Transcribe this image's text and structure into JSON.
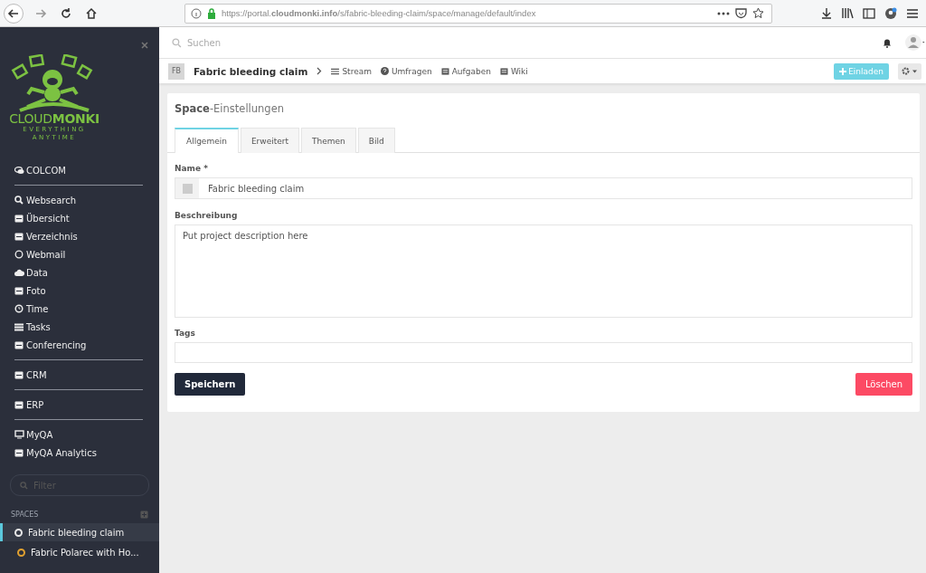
{
  "browser": {
    "url": "https://portal.**cloudmonki.info**/s/fabric-bleeding-claim/space/manage/default/index"
  },
  "sidebar": {
    "logo": {
      "word_light": "CLOUD",
      "word_bold": "MONKI",
      "tagline_1": "EVERYTHING",
      "tagline_2": "ANYTIME"
    },
    "sections": [
      {
        "items": [
          {
            "label": "COLCOM",
            "kind": "chat"
          }
        ]
      },
      {
        "items": [
          {
            "label": "Websearch",
            "kind": "search"
          },
          {
            "label": "Übersicht",
            "kind": "dashboard"
          },
          {
            "label": "Verzeichnis",
            "kind": "book"
          },
          {
            "label": "Webmail",
            "kind": "circle"
          },
          {
            "label": "Data",
            "kind": "cloud"
          },
          {
            "label": "Foto",
            "kind": "image"
          },
          {
            "label": "Time",
            "kind": "clock"
          },
          {
            "label": "Tasks",
            "kind": "list"
          },
          {
            "label": "Conferencing",
            "kind": "share"
          }
        ]
      },
      {
        "items": [
          {
            "label": "CRM",
            "kind": "users"
          }
        ]
      },
      {
        "items": [
          {
            "label": "ERP",
            "kind": "cube"
          }
        ]
      },
      {
        "items": [
          {
            "label": "MyQA",
            "kind": "monitor"
          },
          {
            "label": "MyQA Analytics",
            "kind": "chart"
          }
        ]
      }
    ],
    "filter": {
      "placeholder": "Filter"
    },
    "spaces_heading": "SPACES",
    "spaces": [
      {
        "label": "Fabric bleeding claim",
        "color": "#e8e8e8",
        "selected": true
      },
      {
        "label": "Fabric Polarec with Ho...",
        "color": "#e0a030",
        "selected": false
      }
    ]
  },
  "topbar": {
    "search": {
      "placeholder": "Suchen"
    }
  },
  "space_nav": {
    "initials": "FB",
    "title": "Fabric bleeding claim",
    "links": [
      {
        "label": "Stream",
        "kind": "list"
      },
      {
        "label": "Umfragen",
        "kind": "question"
      },
      {
        "label": "Aufgaben",
        "kind": "tasks"
      },
      {
        "label": "Wiki",
        "kind": "book"
      }
    ],
    "invite_button": "Einladen"
  },
  "panel": {
    "title_bold": "Space",
    "title_rest": "-Einstellungen",
    "tabs": [
      {
        "label": "Allgemein",
        "selected": true
      },
      {
        "label": "Erweitert",
        "selected": false
      },
      {
        "label": "Themen",
        "selected": false
      },
      {
        "label": "Bild",
        "selected": false
      }
    ],
    "name_label": "Name *",
    "name_value": "Fabric bleeding claim",
    "description_label": "Beschreibung",
    "description_placeholder": "Put project description here",
    "tags_label": "Tags",
    "save_button": "Speichern",
    "delete_button": "Löschen"
  }
}
